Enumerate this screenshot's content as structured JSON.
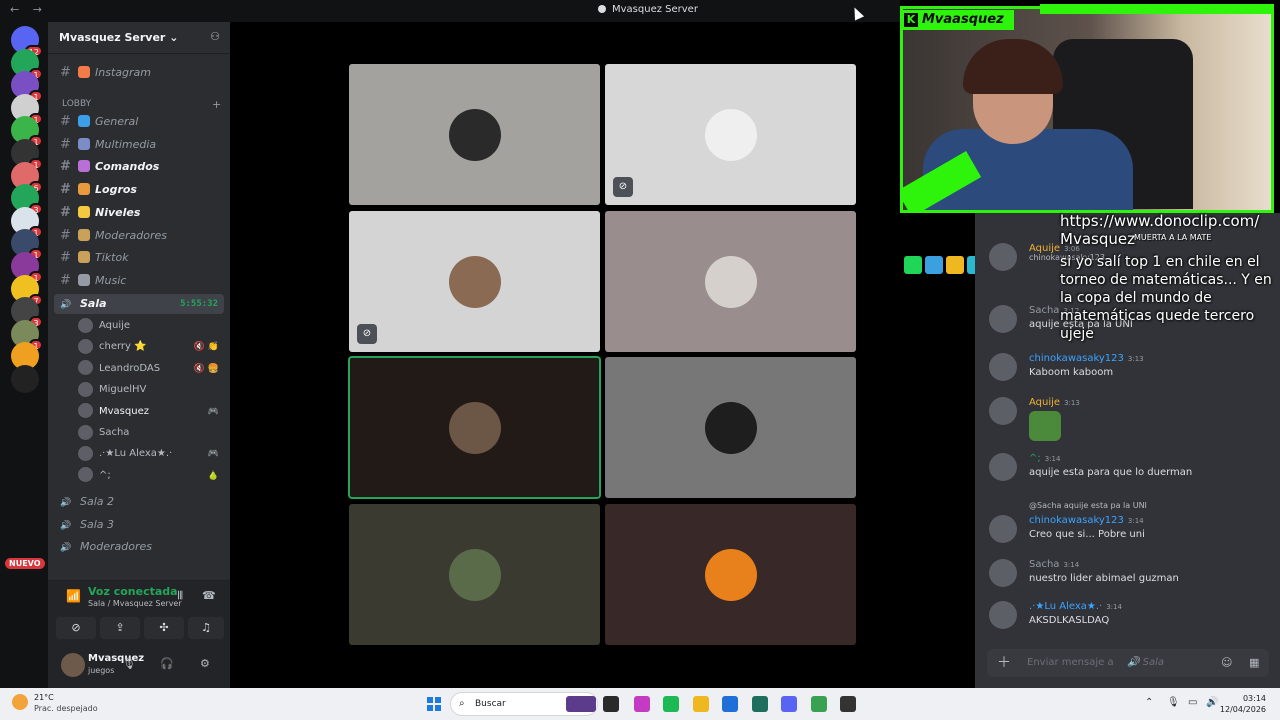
{
  "window": {
    "title": "Mvasquez Server",
    "back": "←",
    "forward": "→"
  },
  "servers": {
    "home_badge": "12",
    "badges": [
      "1",
      "1",
      "1",
      "1",
      "1",
      "6",
      "3",
      "1",
      "1",
      "1",
      "7",
      "3",
      "1",
      "1"
    ],
    "new_label": "NUEVO"
  },
  "sidebar": {
    "server_name": "Mvasquez Server",
    "channels_top": [
      {
        "name": "Instagram",
        "icon_color": "#f47b48"
      }
    ],
    "lobby_category": "LOBBY",
    "channels": [
      {
        "name": "General",
        "icon_color": "#3ba0e8",
        "bold": false
      },
      {
        "name": "Multimedia",
        "icon_color": "#7b8cc8",
        "bold": false
      },
      {
        "name": "Comandos",
        "icon_color": "#b86fd6",
        "bold": true
      },
      {
        "name": "Logros",
        "icon_color": "#e89a3c",
        "bold": true
      },
      {
        "name": "Niveles",
        "icon_color": "#f5c842",
        "bold": true
      },
      {
        "name": "Moderadores",
        "icon_color": "#c9a15a",
        "bold": false
      },
      {
        "name": "Tiktok",
        "icon_color": "#c9a15a",
        "bold": false
      },
      {
        "name": "Music",
        "icon_color": "#949ba4",
        "bold": false
      }
    ],
    "active_voice": {
      "name": "Sala",
      "timer": "5:55:32"
    },
    "voice_users": [
      {
        "name": "Aquije",
        "status": ""
      },
      {
        "name": "cherry ⭐",
        "status": "🔇 👏"
      },
      {
        "name": "LeandroDAS",
        "status": "🔇 🍔"
      },
      {
        "name": "MiguelHV",
        "status": ""
      },
      {
        "name": "Mvasquez",
        "status": "🎮"
      },
      {
        "name": "Sacha",
        "status": ""
      },
      {
        "name": ".·★Lu Alexa★.·",
        "status": "🎮"
      },
      {
        "name": "^;",
        "status": "🍐"
      }
    ],
    "other_voice": [
      {
        "name": "Sala 2"
      },
      {
        "name": "Sala 3"
      },
      {
        "name": "Moderadores"
      }
    ]
  },
  "voice_panel": {
    "status": "Voz conectada",
    "location": "Sala / Mvasquez Server"
  },
  "user_panel": {
    "name": "Mvasquez",
    "status": "juegos"
  },
  "tiles": [
    {
      "bg": "#a4a29f",
      "avatar": "#2a2a2a",
      "muted": false,
      "speaking": false
    },
    {
      "bg": "#d7d7d7",
      "avatar": "#efefef",
      "muted": true,
      "speaking": false
    },
    {
      "bg": "#d4d4d4",
      "avatar": "#8a6a52",
      "muted": true,
      "speaking": false
    },
    {
      "bg": "#9a8d8d",
      "avatar": "#d5d0cc",
      "muted": false,
      "speaking": false
    },
    {
      "bg": "#221a17",
      "avatar": "#6c5646",
      "muted": false,
      "speaking": true
    },
    {
      "bg": "#777777",
      "avatar": "#1e1e1e",
      "muted": false,
      "speaking": false
    },
    {
      "bg": "#3b3a30",
      "avatar": "#5a6b4a",
      "muted": false,
      "speaking": false
    },
    {
      "bg": "#382828",
      "avatar": "#e8801c",
      "muted": false,
      "speaking": false
    }
  ],
  "stream": {
    "streamer": "Mvaasquez",
    "tts_url": "https://www.donoclip.com/",
    "tts_name": "Mvasquez",
    "tts_sub": "MUERTA A LA MATE",
    "tts_message": "si yo salí top 1 en chile en el torneo de matemáticas... Y en la copa del mundo de matemáticas quede tercero ujeje",
    "badge_colors": [
      "#1fd659",
      "#3aa0e0",
      "#f0b820",
      "#2ab8d0",
      "#f0b820"
    ]
  },
  "chat": {
    "messages": [
      {
        "author": "Aquije",
        "color": "#f0b232",
        "time": "3:06",
        "text": "",
        "reply": "chinokawasaky123"
      },
      {
        "author": "Sacha",
        "color": "#949ba4",
        "time": "3:12",
        "text": "aquije esta pa la UNI",
        "reply": ""
      },
      {
        "author": "chinokawasaky123",
        "color": "#3ba4ff",
        "time": "3:13",
        "text": "Kaboom kaboom",
        "reply": ""
      },
      {
        "author": "Aquije",
        "color": "#f0b232",
        "time": "3:13",
        "text": "",
        "reply": ""
      },
      {
        "author": "^;",
        "color": "#23a55a",
        "time": "3:14",
        "text": "aquije esta para que lo  duerman",
        "reply": ""
      },
      {
        "author": "chinokawasaky123",
        "color": "#3ba4ff",
        "time": "3:14",
        "text": "Creo que si... Pobre uni",
        "reply": "@Sacha aquije esta pa la UNI"
      },
      {
        "author": "Sacha",
        "color": "#949ba4",
        "time": "3:14",
        "text": "nuestro lider abimael guzman",
        "reply": ""
      },
      {
        "author": ".·★Lu Alexa★.·",
        "color": "#3ba4ff",
        "time": "3:14",
        "text": "AKSDLKASLDAQ",
        "reply": ""
      }
    ],
    "input_placeholder": "Enviar mensaje a",
    "input_channel": "Sala"
  },
  "taskbar": {
    "temp": "21°C",
    "condition": "Prac. despejado",
    "search": "Buscar",
    "time": "03:14",
    "date": "12/04/2026",
    "app_colors": [
      "#5c3c8a",
      "#2a2a2a",
      "#c23bc2",
      "#1db954",
      "#f0b820",
      "#1f6fd6",
      "#1e6f5e",
      "#5865f2",
      "#3aa052",
      "#333"
    ]
  }
}
